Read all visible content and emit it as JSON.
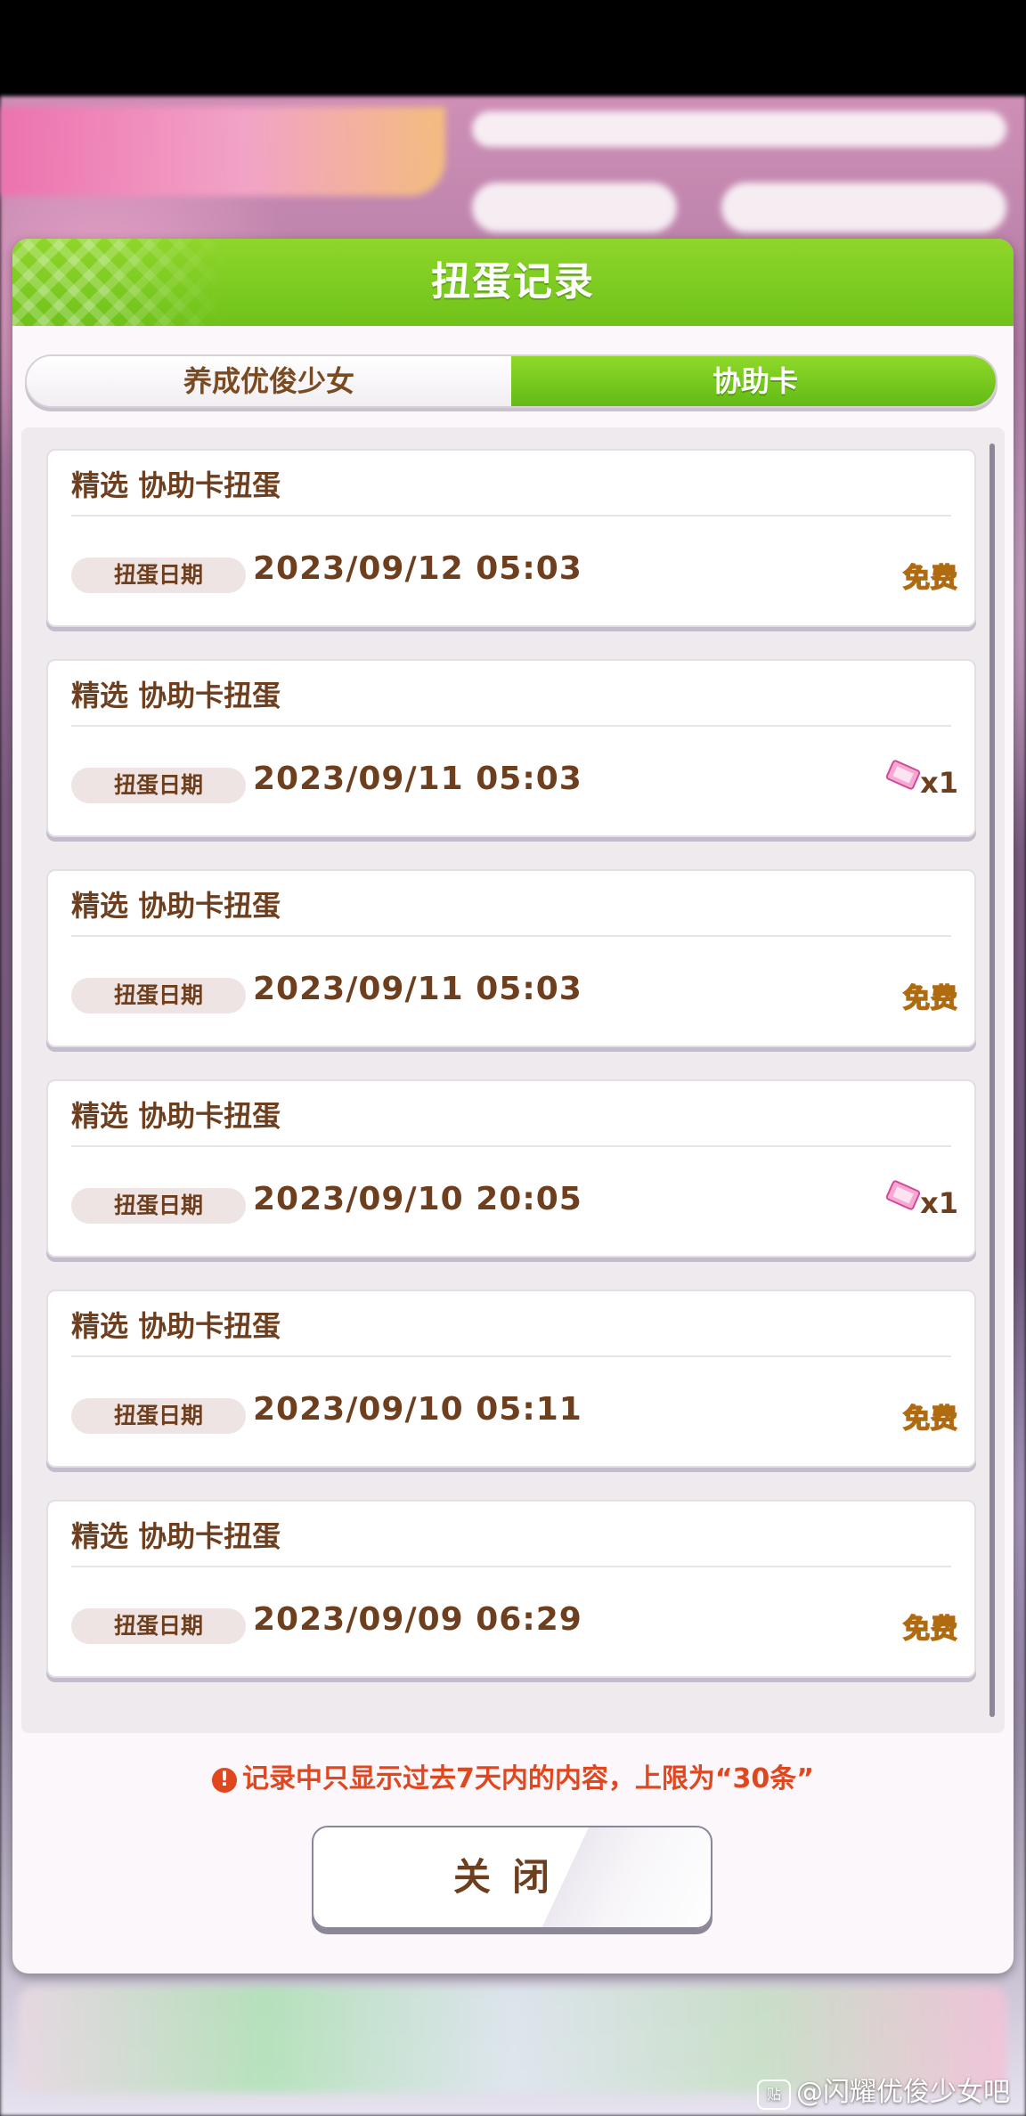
{
  "dialog": {
    "title": "扭蛋记录",
    "tabs": [
      {
        "label": "养成优俊少女",
        "active": false
      },
      {
        "label": "协助卡",
        "active": true
      }
    ],
    "date_label": "扭蛋日期",
    "records": [
      {
        "name": "精选  协助卡扭蛋",
        "date": "2023/09/12  05:03",
        "cost_type": "free",
        "cost_text": "免费"
      },
      {
        "name": "精选  协助卡扭蛋",
        "date": "2023/09/11  05:03",
        "cost_type": "ticket",
        "cost_text": "x1",
        "cost_icon": "ticket-icon"
      },
      {
        "name": "精选  协助卡扭蛋",
        "date": "2023/09/11  05:03",
        "cost_type": "free",
        "cost_text": "免费"
      },
      {
        "name": "精选  协助卡扭蛋",
        "date": "2023/09/10  20:05",
        "cost_type": "ticket",
        "cost_text": "x1",
        "cost_icon": "ticket-icon"
      },
      {
        "name": "精选  协助卡扭蛋",
        "date": "2023/09/10  05:11",
        "cost_type": "free",
        "cost_text": "免费"
      },
      {
        "name": "精选  协助卡扭蛋",
        "date": "2023/09/09  06:29",
        "cost_type": "free",
        "cost_text": "免费"
      }
    ],
    "notice": "记录中只显示过去7天内的内容，上限为“30条”",
    "notice_icon": "!",
    "close_label": "关闭"
  },
  "watermark": {
    "text": "@闪耀优俊少女吧",
    "logo": "贴"
  },
  "colors": {
    "header_green": "#7ccb20",
    "text_brown": "#6e3f1e",
    "notice_red": "#e0471f",
    "free_gold": "#ffcf3a"
  }
}
